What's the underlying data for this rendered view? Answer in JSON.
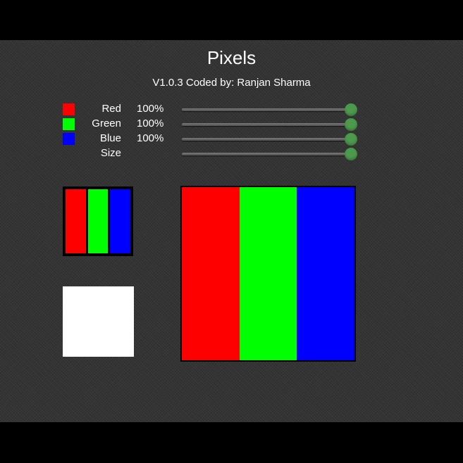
{
  "app": {
    "title": "Pixels",
    "subtitle": "V1.0.3 Coded by: Ranjan Sharma"
  },
  "controls": [
    {
      "name": "red",
      "label": "Red",
      "value_text": "100%",
      "level": 1.0,
      "swatch_color": "#ff0000"
    },
    {
      "name": "green",
      "label": "Green",
      "value_text": "100%",
      "level": 1.0,
      "swatch_color": "#00ff00"
    },
    {
      "name": "blue",
      "label": "Blue",
      "value_text": "100%",
      "level": 1.0,
      "swatch_color": "#0000ff"
    },
    {
      "name": "size",
      "label": "Size",
      "value_text": "",
      "level": 1.0,
      "swatch_color": ""
    }
  ],
  "colors": {
    "red": "#ff0000",
    "green": "#00ff00",
    "blue": "#0000ff",
    "blended": "#ffffff",
    "slider_thumb": "#4c9a4c",
    "background": "#333333"
  }
}
